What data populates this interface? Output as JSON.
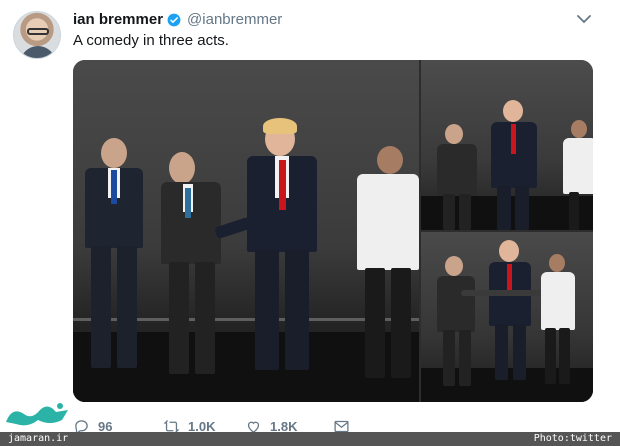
{
  "tweet": {
    "author_name": "ian bremmer",
    "handle": "@ianbremmer",
    "text": "A comedy in three acts."
  },
  "media": {
    "watermark": "Ja"
  },
  "actions": {
    "reply_count": "",
    "reply_count_label": "96",
    "retweet_count": "1.0K",
    "like_count": "1.8K"
  },
  "footer": {
    "left": "jamaran.ir",
    "right": "Photo:twitter"
  },
  "icons": {
    "verified": "verified-badge-icon",
    "menu": "chevron-down-icon",
    "reply": "reply-icon",
    "retweet": "retweet-icon",
    "like": "heart-icon",
    "dm": "envelope-icon"
  },
  "colors": {
    "verified_blue": "#1da1f2",
    "secondary_text": "#657786",
    "footer_bar": "#555555",
    "logo_teal": "#2ab3a6"
  }
}
